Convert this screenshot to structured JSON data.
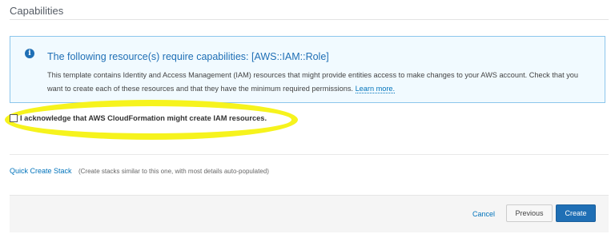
{
  "section": {
    "title": "Capabilities"
  },
  "info_box": {
    "icon": "info-icon",
    "heading": "The following resource(s) require capabilities: [AWS::IAM::Role]",
    "body": "This template contains Identity and Access Management (IAM) resources that might provide entities access to make changes to your AWS account. Check that you want to create each of these resources and that they have the minimum required permissions.",
    "link_label": "Learn more."
  },
  "acknowledge": {
    "label": "I acknowledge that AWS CloudFormation might create IAM resources.",
    "checked": false
  },
  "quick_create": {
    "link_label": "Quick Create Stack",
    "description": "(Create stacks similar to this one, with most details auto-populated)"
  },
  "footer": {
    "cancel_label": "Cancel",
    "previous_label": "Previous",
    "create_label": "Create"
  },
  "colors": {
    "accent": "#1f6fb5",
    "link": "#0073bb",
    "info_border": "#8cc6ec",
    "info_background": "#f1faff",
    "highlight": "#f6f31d"
  }
}
